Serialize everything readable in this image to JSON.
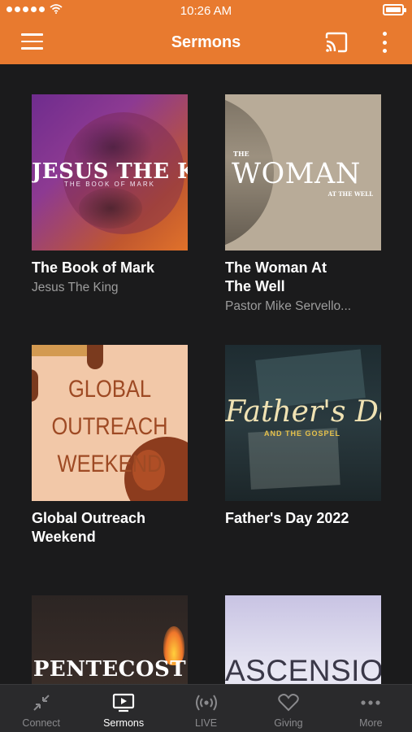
{
  "status": {
    "time": "10:26 AM"
  },
  "header": {
    "title": "Sermons"
  },
  "colors": {
    "accent": "#e87a2f",
    "background": "#1b1b1c",
    "tabbar": "#2a2a2c",
    "subtitle": "#9c9c9c"
  },
  "icons": {
    "menu": "hamburger-icon",
    "cast": "cast-icon",
    "more": "kebab-icon"
  },
  "sermons": [
    {
      "title": "The Book of Mark",
      "subtitle": "Jesus The King",
      "art": {
        "main": "JESUS THE KING",
        "small": "THE BOOK OF MARK"
      }
    },
    {
      "title": "The Woman At The Well",
      "subtitle": "Pastor Mike Servello...",
      "art": {
        "top": "THE",
        "main": "WOMAN",
        "small": "AT THE WELL"
      }
    },
    {
      "title": "Global Outreach Weekend",
      "subtitle": "",
      "art": {
        "line1": "GLOBAL",
        "line2": "OUTREACH",
        "line3": "WEEKEND"
      }
    },
    {
      "title": "Father's Day 2022",
      "subtitle": "",
      "art": {
        "main": "Father's Day",
        "small": "AND THE GOSPEL"
      }
    },
    {
      "title": "",
      "subtitle": "",
      "art": {
        "main": "PENTECOST"
      }
    },
    {
      "title": "",
      "subtitle": "",
      "art": {
        "main": "ASCENSION"
      }
    }
  ],
  "tabs": [
    {
      "label": "Connect",
      "icon": "connect-icon",
      "active": false
    },
    {
      "label": "Sermons",
      "icon": "tv-icon",
      "active": true
    },
    {
      "label": "LIVE",
      "icon": "broadcast-icon",
      "active": false
    },
    {
      "label": "Giving",
      "icon": "heart-icon",
      "active": false
    },
    {
      "label": "More",
      "icon": "more-dots-icon",
      "active": false
    }
  ]
}
